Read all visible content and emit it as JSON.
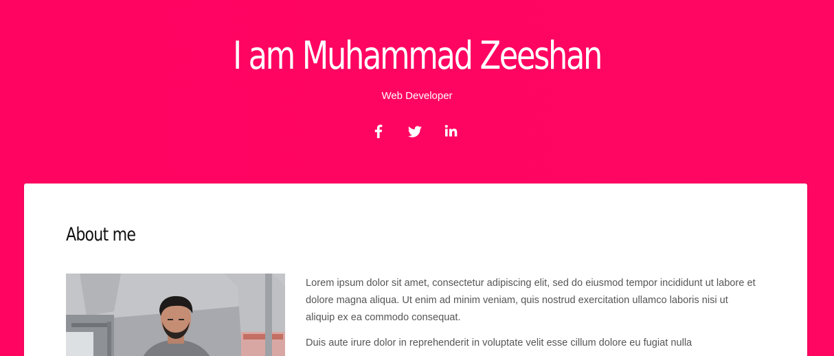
{
  "header": {
    "title": "I am Muhammad Zeeshan",
    "subtitle": "Web Developer",
    "social": [
      {
        "icon": "facebook-icon"
      },
      {
        "icon": "twitter-icon"
      },
      {
        "icon": "linkedin-icon"
      }
    ]
  },
  "about": {
    "title": "About me",
    "paragraphs": [
      "Lorem ipsum dolor sit amet, consectetur adipiscing elit, sed do eiusmod tempor incididunt ut labore et dolore magna aliqua. Ut enim ad minim veniam, quis nostrud exercitation ullamco laboris nisi ut aliquip ex ea commodo consequat.",
      "Duis aute irure dolor in reprehenderit in voluptate velit esse cillum dolore eu fugiat nulla"
    ]
  },
  "colors": {
    "accent": "#ff0661",
    "card": "#ffffff",
    "text": "#555555"
  }
}
